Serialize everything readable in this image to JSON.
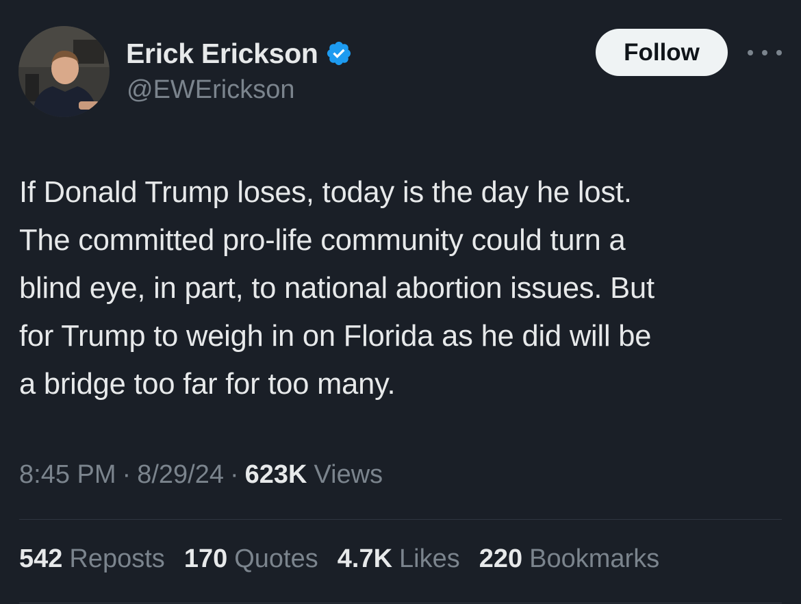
{
  "author": {
    "display_name": "Erick Erickson",
    "handle": "@EWErickson",
    "verified": true,
    "verified_color": "#1d9bf0"
  },
  "actions": {
    "follow_label": "Follow",
    "more_icon": "more-horizontal-icon"
  },
  "tweet": {
    "text": "If Donald Trump loses, today is the day he lost.\nThe committed pro-life community could turn a\nblind eye, in part, to national abortion issues. But\nfor Trump to weigh in on Florida as he did will be\na bridge too far for too many."
  },
  "meta": {
    "time": "8:45 PM",
    "date": "8/29/24",
    "separator": "·",
    "views_count": "623K",
    "views_label": "Views"
  },
  "stats": [
    {
      "count": "542",
      "label": "Reposts"
    },
    {
      "count": "170",
      "label": "Quotes"
    },
    {
      "count": "4.7K",
      "label": "Likes"
    },
    {
      "count": "220",
      "label": "Bookmarks"
    }
  ],
  "colors": {
    "background": "#1a1f27",
    "primary_text": "#e7e9ea",
    "secondary_text": "#7b848d",
    "follow_bg": "#eff3f4",
    "follow_text": "#0f1419"
  }
}
